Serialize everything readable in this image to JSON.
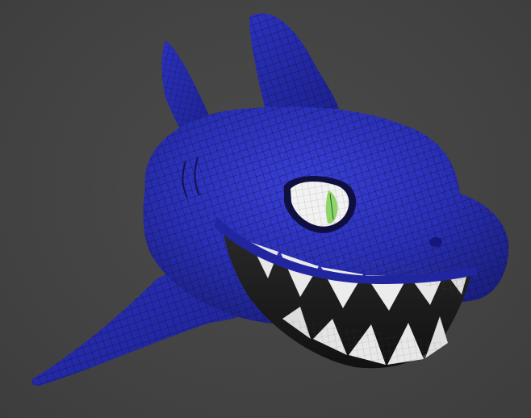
{
  "viewport": {
    "background_color": "#444444",
    "model_color": "#2a2fb8",
    "wire_color": "#0b0d3a",
    "teeth_color": "#e8e8e8",
    "eye_white_color": "#f2f2f2",
    "iris_color": "#8fd46a"
  }
}
